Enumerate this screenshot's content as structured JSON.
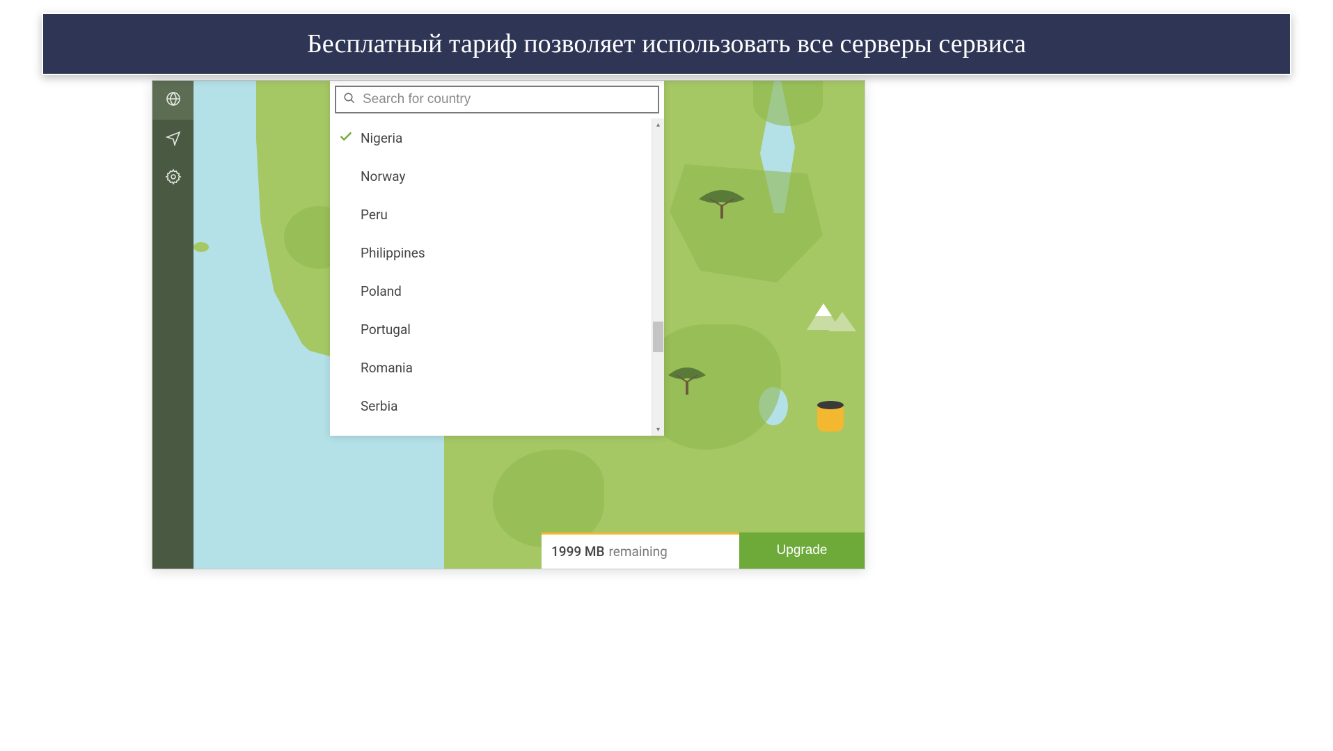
{
  "banner": {
    "text": "Бесплатный тариф позволяет использовать все серверы сервиса"
  },
  "sidebar": {
    "items": [
      {
        "name": "globe",
        "active": true
      },
      {
        "name": "broadcast",
        "active": false
      },
      {
        "name": "settings",
        "active": false
      }
    ]
  },
  "search": {
    "placeholder": "Search for country"
  },
  "countries": [
    {
      "name": "Nigeria",
      "selected": true
    },
    {
      "name": "Norway",
      "selected": false
    },
    {
      "name": "Peru",
      "selected": false
    },
    {
      "name": "Philippines",
      "selected": false
    },
    {
      "name": "Poland",
      "selected": false
    },
    {
      "name": "Portugal",
      "selected": false
    },
    {
      "name": "Romania",
      "selected": false
    },
    {
      "name": "Serbia",
      "selected": false
    }
  ],
  "status": {
    "data_amount": "1999 MB",
    "data_label": "remaining",
    "upgrade_label": "Upgrade"
  },
  "colors": {
    "banner_bg": "#2e3555",
    "sidebar_bg": "#4a5a42",
    "water": "#b4e0e8",
    "land": "#a5c864",
    "upgrade": "#6daa3a",
    "accent_orange": "#f3b82f"
  }
}
